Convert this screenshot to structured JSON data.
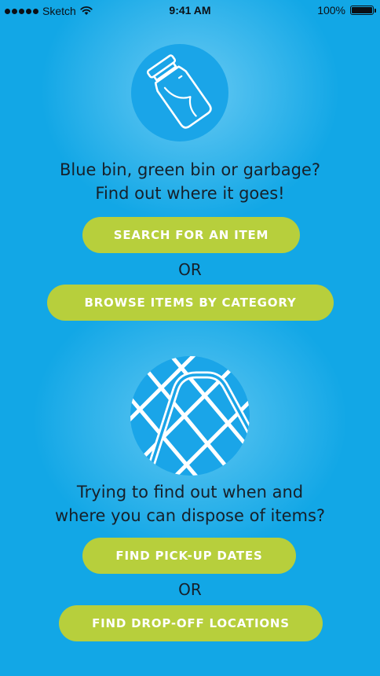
{
  "status_bar": {
    "carrier": "Sketch",
    "time": "9:41 AM",
    "battery": "100%"
  },
  "section_sort": {
    "icon": "jar-icon",
    "line1": "Blue bin, green bin or garbage?",
    "line2": "Find out where it goes!",
    "primary_button": "SEARCH FOR AN ITEM",
    "or_label": "OR",
    "secondary_button": "BROWSE ITEMS BY CATEGORY"
  },
  "section_dispose": {
    "icon": "map-icon",
    "line1": "Trying to find out when and",
    "line2": "where you can dispose of items?",
    "primary_button": "FIND PICK-UP DATES",
    "or_label": "OR",
    "secondary_button": "FIND DROP-OFF LOCATIONS"
  },
  "colors": {
    "background": "#12a7e6",
    "circle": "#1aa5e8",
    "button": "#b7cf3c",
    "button_text": "#ffffff",
    "text": "#16202a"
  }
}
